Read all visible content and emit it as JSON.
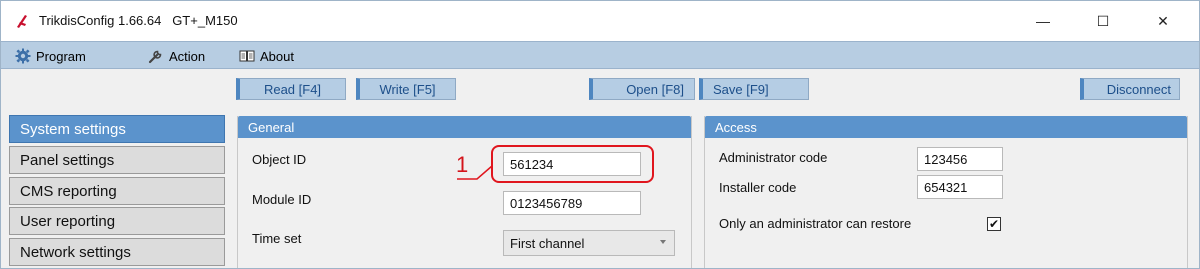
{
  "window": {
    "title": "TrikdisConfig 1.66.64   GT+_M150",
    "minimize_glyph": "—",
    "maximize_glyph": "☐",
    "close_glyph": "✕"
  },
  "menu": {
    "program": "Program",
    "action": "Action",
    "about": "About"
  },
  "toolbar": {
    "read": "Read [F4]",
    "write": "Write [F5]",
    "open": "Open [F8]",
    "save": "Save [F9]",
    "disconnect": "Disconnect"
  },
  "sidebar": {
    "items": [
      {
        "label": "System settings",
        "active": true
      },
      {
        "label": "Panel settings",
        "active": false
      },
      {
        "label": "CMS reporting",
        "active": false
      },
      {
        "label": "User reporting",
        "active": false
      },
      {
        "label": "Network settings",
        "active": false
      }
    ]
  },
  "general": {
    "header": "General",
    "object_id_label": "Object ID",
    "object_id_value": "561234",
    "module_id_label": "Module ID",
    "module_id_value": "0123456789",
    "time_set_label": "Time set",
    "time_set_value": "First channel"
  },
  "access": {
    "header": "Access",
    "admin_code_label": "Administrator code",
    "admin_code_value": "123456",
    "installer_code_label": "Installer code",
    "installer_code_value": "654321",
    "admin_restore_label": "Only an administrator can restore",
    "admin_restore_checked": true
  },
  "annotation": {
    "number": "1",
    "color": "#e0161e"
  },
  "colors": {
    "accent": "#5b93cc",
    "menubar": "#b7cde2",
    "toolbar_button": "#b5cde4"
  }
}
